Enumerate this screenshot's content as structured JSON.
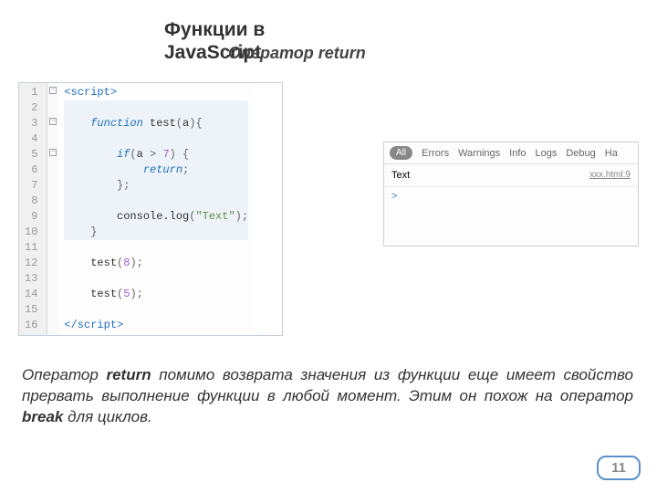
{
  "heading": {
    "title_line1": "Функции в",
    "title_line2": "JavaScript",
    "subtitle": "Оператор return"
  },
  "code": {
    "lines": [
      "1",
      "2",
      "3",
      "4",
      "5",
      "6",
      "7",
      "8",
      "9",
      "10",
      "11",
      "12",
      "13",
      "14",
      "15",
      "16"
    ],
    "openTag": "<script>",
    "closeTag": "</script>",
    "funcKw": "function",
    "funcName": "test",
    "funcParam": "a",
    "ifKw": "if",
    "ifCond_a": "a",
    "ifCond_gt": " > ",
    "ifCond_7": "7",
    "returnKw": "return",
    "consoleCall": "console.log",
    "textStr": "\"Text\"",
    "call1_name": "test",
    "call1_arg": "8",
    "call2_name": "test",
    "call2_arg": "5"
  },
  "console": {
    "tabs": {
      "all": "All",
      "errors": "Errors",
      "warnings": "Warnings",
      "info": "Info",
      "logs": "Logs",
      "debug": "Debug",
      "ha": "Ha"
    },
    "output_text": "Text",
    "output_src": "xxx.html:9",
    "prompt": ">"
  },
  "paragraph": {
    "p1": "Оператор ",
    "b1": "return",
    "p2": " помимо возврата значения из функции еще имеет свойство прервать выполнение функции в любой момент. Этим он похож на оператор ",
    "b2": "break",
    "p3": " для циклов."
  },
  "pageNumber": "11"
}
